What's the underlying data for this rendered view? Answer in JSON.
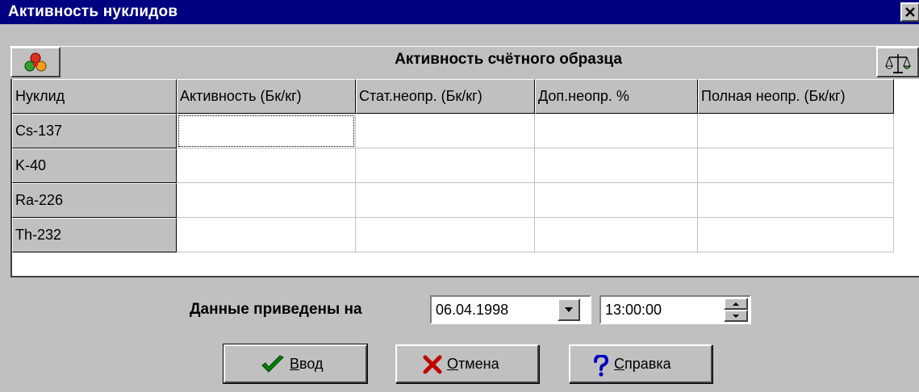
{
  "window": {
    "title": "Активность нуклидов",
    "close_icon": "close-x-icon"
  },
  "header": {
    "title": "Активность счётного образца",
    "left_icon": "nuclide-atom-icon",
    "right_icon": "scales-icon"
  },
  "grid": {
    "columns": [
      "Нуклид",
      "Активность (Бк/кг)",
      "Стат.неопр. (Бк/кг)",
      "Доп.неопр. %",
      "Полная неопр. (Бк/кг)"
    ],
    "rows": [
      {
        "nuclide": "Cs-137",
        "activity": "",
        "stat": "",
        "add": "",
        "full": ""
      },
      {
        "nuclide": "K-40",
        "activity": "",
        "stat": "",
        "add": "",
        "full": ""
      },
      {
        "nuclide": "Ra-226",
        "activity": "",
        "stat": "",
        "add": "",
        "full": ""
      },
      {
        "nuclide": "Th-232",
        "activity": "",
        "stat": "",
        "add": "",
        "full": ""
      }
    ],
    "focused_cell": "row 0, activity"
  },
  "date_row": {
    "label": "Данные приведены на",
    "date_value": "06.04.1998",
    "time_value": "13:00:00"
  },
  "buttons": {
    "ok": {
      "mnemonic": "В",
      "rest": "вод",
      "icon": "checkmark-icon"
    },
    "cancel": {
      "mnemonic": "О",
      "rest": "тмена",
      "icon": "red-x-icon"
    },
    "help": {
      "mnemonic": "С",
      "rest": "правка",
      "icon": "question-mark-icon"
    }
  },
  "colors": {
    "titlebar": "#000080",
    "face": "#c0c0c0",
    "check": "#008000",
    "cancel_x": "#c00000",
    "help_q": "#0000c0"
  }
}
